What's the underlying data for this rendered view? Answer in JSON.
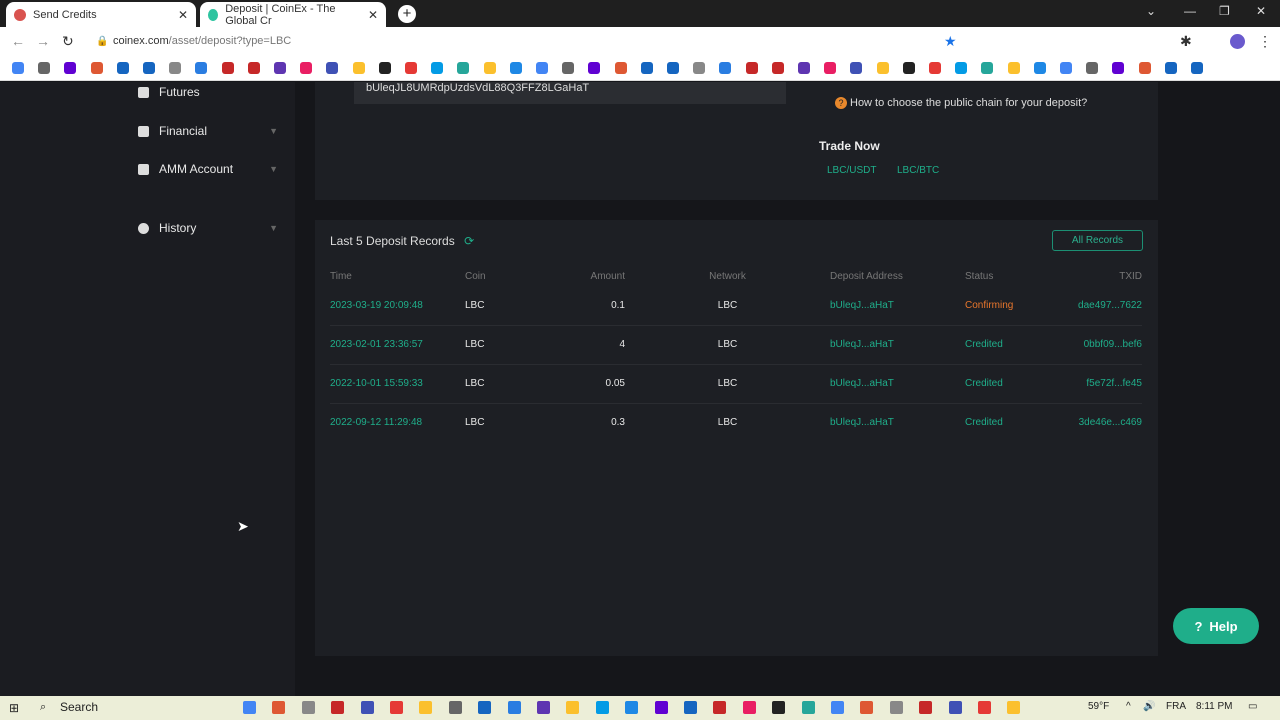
{
  "browser": {
    "tabs": [
      {
        "title": "Send Credits"
      },
      {
        "title": "Deposit | CoinEx - The Global Cr"
      }
    ],
    "url_host": "coinex.com",
    "url_path": "/asset/deposit?type=LBC"
  },
  "sidebar": {
    "items": [
      {
        "label": "Futures"
      },
      {
        "label": "Financial"
      },
      {
        "label": "AMM Account"
      },
      {
        "label": "History"
      }
    ]
  },
  "deposit": {
    "address": "bUleqJL8UMRdpUzdsVdL88Q3FFZ8LGaHaT",
    "help_link": "How to choose the public chain for your deposit?",
    "trade_now": "Trade Now",
    "pairs": [
      "LBC/USDT",
      "LBC/BTC"
    ]
  },
  "records": {
    "title": "Last 5 Deposit Records",
    "all_records": "All Records",
    "columns": [
      "Time",
      "Coin",
      "Amount",
      "Network",
      "Deposit Address",
      "Status",
      "TXID"
    ],
    "rows": [
      [
        "2023-03-19 20:09:48",
        "LBC",
        "0.1",
        "LBC",
        "bUleqJ...aHaT",
        "Confirming",
        "dae497...7622"
      ],
      [
        "2023-02-01 23:36:57",
        "LBC",
        "4",
        "LBC",
        "bUleqJ...aHaT",
        "Credited",
        "0bbf09...bef6"
      ],
      [
        "2022-10-01 15:59:33",
        "LBC",
        "0.05",
        "LBC",
        "bUleqJ...aHaT",
        "Credited",
        "f5e72f...fe45"
      ],
      [
        "2022-09-12 11:29:48",
        "LBC",
        "0.3",
        "LBC",
        "bUleqJ...aHaT",
        "Credited",
        "3de46e...c469"
      ]
    ]
  },
  "help_button": "Help",
  "taskbar": {
    "search": "Search",
    "weather": "59°F",
    "lang": "FRA",
    "time": "8:11 PM"
  },
  "colors": {
    "accent": "#1fae8a",
    "confirming": "#e8762c"
  }
}
